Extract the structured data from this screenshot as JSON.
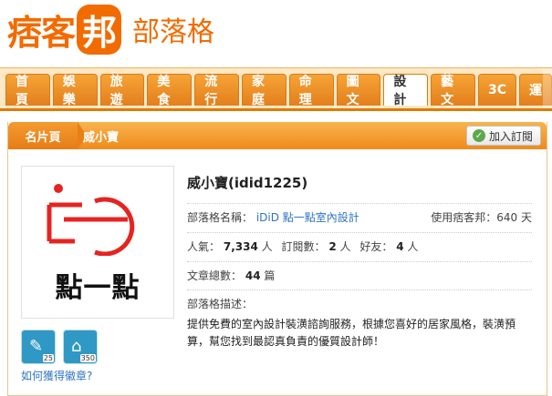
{
  "header": {
    "logo_main_1": "痞客",
    "logo_main_2": "邦",
    "logo_sub": "部落格"
  },
  "nav": {
    "items": [
      "首頁",
      "娛樂",
      "旅遊",
      "美食",
      "流行",
      "家庭",
      "命理",
      "圖文",
      "設計",
      "藝文",
      "3C",
      "運"
    ]
  },
  "profile": {
    "tab_label": "名片頁",
    "display_name": "威小寶",
    "follow_label": "加入訂閱",
    "avatar_text": "點一點",
    "name_with_id": "威小寶(idid1225)",
    "blog_name_label": "部落格名稱：",
    "blog_name_value": "iDiD 點一點室內設計",
    "usage_label": "使用痞客邦：",
    "usage_value": "640 天",
    "popularity_label": "人氣：",
    "popularity_value": "7,334",
    "person_unit": "人",
    "subscribers_label": "訂閱數：",
    "subscribers_value": "2",
    "friends_label": "好友：",
    "friends_value": "4",
    "articles_label": "文章總數：",
    "articles_value": "44",
    "articles_unit": "篇",
    "desc_label": "部落格描述：",
    "desc_value": "提供免費的室內設計裝潢諮詢服務，根據您喜好的居家風格，裝潢預算，幫您找到最認真負責的優質設計師！",
    "badges": [
      {
        "count": "25"
      },
      {
        "count": "350"
      }
    ],
    "badge_help": "如何獲得徽章?"
  }
}
